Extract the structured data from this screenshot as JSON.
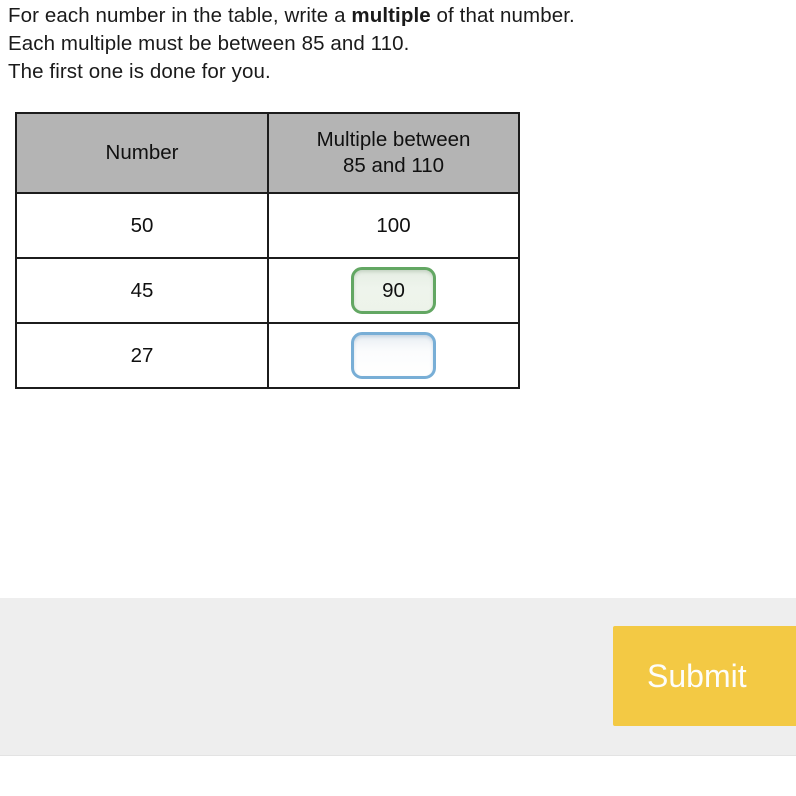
{
  "question": {
    "line1_before": "For each number in the table, write a ",
    "line1_bold": "multiple",
    "line1_after": " of that number.",
    "line2": "Each multiple must be between 85 and 110.",
    "line3": "The first one is done for you."
  },
  "table": {
    "headers": {
      "number": "Number",
      "multiple_line1": "Multiple between",
      "multiple_line2": "85 and 110"
    },
    "rows": [
      {
        "number": "50",
        "multiple": "100",
        "kind": "static"
      },
      {
        "number": "45",
        "multiple": "90",
        "kind": "input-filled"
      },
      {
        "number": "27",
        "multiple": "",
        "kind": "input-empty"
      }
    ]
  },
  "footer": {
    "submit_label": "Submit"
  },
  "colors": {
    "header_gray": "#b4b4b4",
    "table_border": "#1c1c1c",
    "correct_green_border": "#63a763",
    "correct_green_fill": "#edf3ea",
    "active_blue_border": "#78aed6",
    "footer_gray": "#eeeeee",
    "submit_yellow": "#f3c944",
    "submit_text": "#fdfdfa"
  }
}
